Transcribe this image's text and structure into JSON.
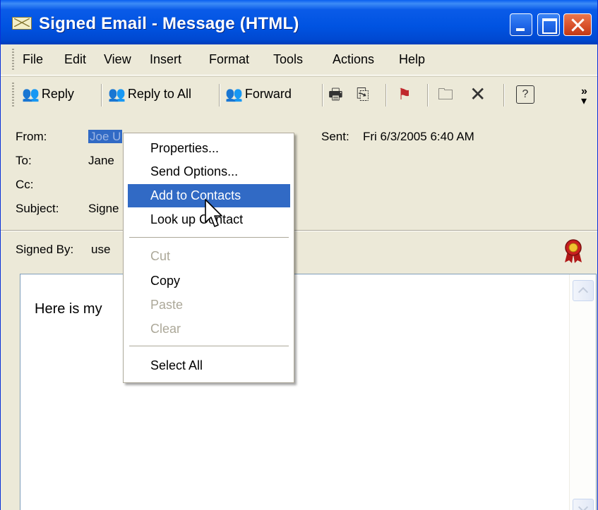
{
  "window": {
    "title": "Signed Email - Message (HTML)",
    "icon": "envelope-icon"
  },
  "menu": [
    "File",
    "Edit",
    "View",
    "Insert",
    "Format",
    "Tools",
    "Actions",
    "Help"
  ],
  "toolbar": {
    "reply": "Reply",
    "reply_all": "Reply to All",
    "forward": "Forward",
    "icons": [
      "print-icon",
      "copy-icon",
      "flag-icon",
      "move-to-folder-icon",
      "delete-icon",
      "help-icon"
    ]
  },
  "header": {
    "from_label": "From:",
    "from_value": "Joe U",
    "to_label": "To:",
    "to_value": "Jane",
    "cc_label": "Cc:",
    "subject_label": "Subject:",
    "subject_value": "Signe",
    "sent_label": "Sent:",
    "sent_value": "Fri 6/3/2005 6:40 AM",
    "signed_by_label": "Signed By:",
    "signed_by_value": "use"
  },
  "body": {
    "text": "Here is my"
  },
  "context_menu": {
    "items": [
      {
        "label": "Properties...",
        "disabled": false
      },
      {
        "label": "Send Options...",
        "disabled": false
      },
      {
        "label": "Add to Contacts",
        "disabled": false,
        "highlighted": true
      },
      {
        "label": "Look up Contact",
        "disabled": false
      },
      {
        "label": "Cut",
        "disabled": true
      },
      {
        "label": "Copy",
        "disabled": false
      },
      {
        "label": "Paste",
        "disabled": true
      },
      {
        "label": "Clear",
        "disabled": true
      },
      {
        "label": "Select All",
        "disabled": false
      }
    ]
  },
  "colors": {
    "titlebar": "#0053E1",
    "selection": "#316AC5",
    "chrome": "#ECE9D8",
    "disabled_text": "#ACA899"
  }
}
